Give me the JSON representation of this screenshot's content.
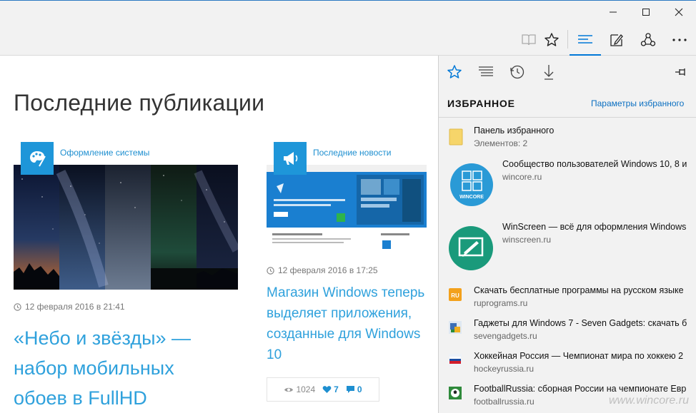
{
  "window": {
    "title": ""
  },
  "toolbar": {
    "reading_view": "reading-view-icon",
    "favorite": "star-icon",
    "hub": "hub-icon",
    "note": "web-note-icon",
    "share": "share-icon",
    "more": "more-icon"
  },
  "page": {
    "title": "Последние публикации",
    "cards": [
      {
        "category": "Оформление системы",
        "date": "12 февраля 2016 в 21:41",
        "headline": "«Небо и звёзды» — набор мобильных обоев в FullHD"
      },
      {
        "category": "Последние новости",
        "date": "12 февраля 2016 в 17:25",
        "headline": "Магазин Windows теперь выделяет приложения, созданные для Windows 10",
        "stats": {
          "views": "1024",
          "likes": "7",
          "comments": "0"
        }
      }
    ]
  },
  "hub": {
    "heading": "ИЗБРАННОЕ",
    "settings_link": "Параметры избранного",
    "items": [
      {
        "title": "Панель избранного",
        "subtitle": "Элементов: 2",
        "icon": "folder-icon"
      },
      {
        "title": "Сообщество пользователей Windows 10, 8 и",
        "subtitle": "wincore.ru",
        "icon": "wincore-tile"
      },
      {
        "title": "WinScreen — всё для оформления Windows",
        "subtitle": "winscreen.ru",
        "icon": "winscreen-tile"
      },
      {
        "title": "Скачать бесплатные программы на русском языке",
        "subtitle": "ruprograms.ru",
        "icon": "ruprograms-favicon"
      },
      {
        "title": "Гаджеты для Windows 7 - Seven Gadgets: скачать б",
        "subtitle": "sevengadgets.ru",
        "icon": "sevengadgets-favicon"
      },
      {
        "title": "Хоккейная Россия — Чемпионат мира по хоккею 2",
        "subtitle": "hockeyrussia.ru",
        "icon": "hockeyrussia-favicon"
      },
      {
        "title": "FootballRussia: сборная России на чемпионате Евр",
        "subtitle": "footballrussia.ru",
        "icon": "footballrussia-favicon"
      }
    ],
    "wincore_tile_label": "WINCORE"
  },
  "watermark": "www.wincore.ru",
  "colors": {
    "accent": "#0078d7",
    "link": "#2fa1dc",
    "tile": "#1e96d9",
    "wincore": "#2a9ad6",
    "winscreen": "#1a9a7b"
  }
}
